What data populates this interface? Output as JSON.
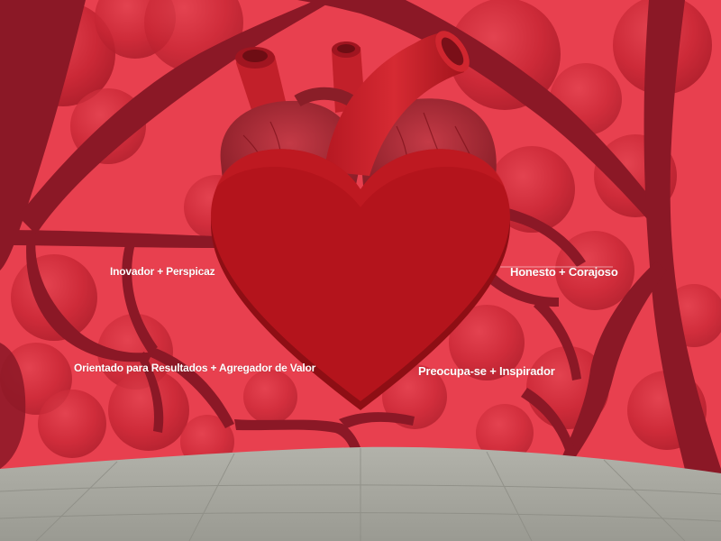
{
  "colors": {
    "background": "#e8404f",
    "cell": "#c4222f",
    "cell_highlight": "#ef6a74",
    "vessel": "#8b1826",
    "heart_front": "#b4141c",
    "heart_side": "#8e0e14",
    "floor": "#a3a39b",
    "label_text": "#ffffff"
  },
  "labels": {
    "innovative": "Inovador + Perspicaz",
    "honest": "Honesto + Corajoso",
    "results": "Orientado para Resultados + Agregador de Valor",
    "caring": "Preocupa-se + Inspirador"
  }
}
